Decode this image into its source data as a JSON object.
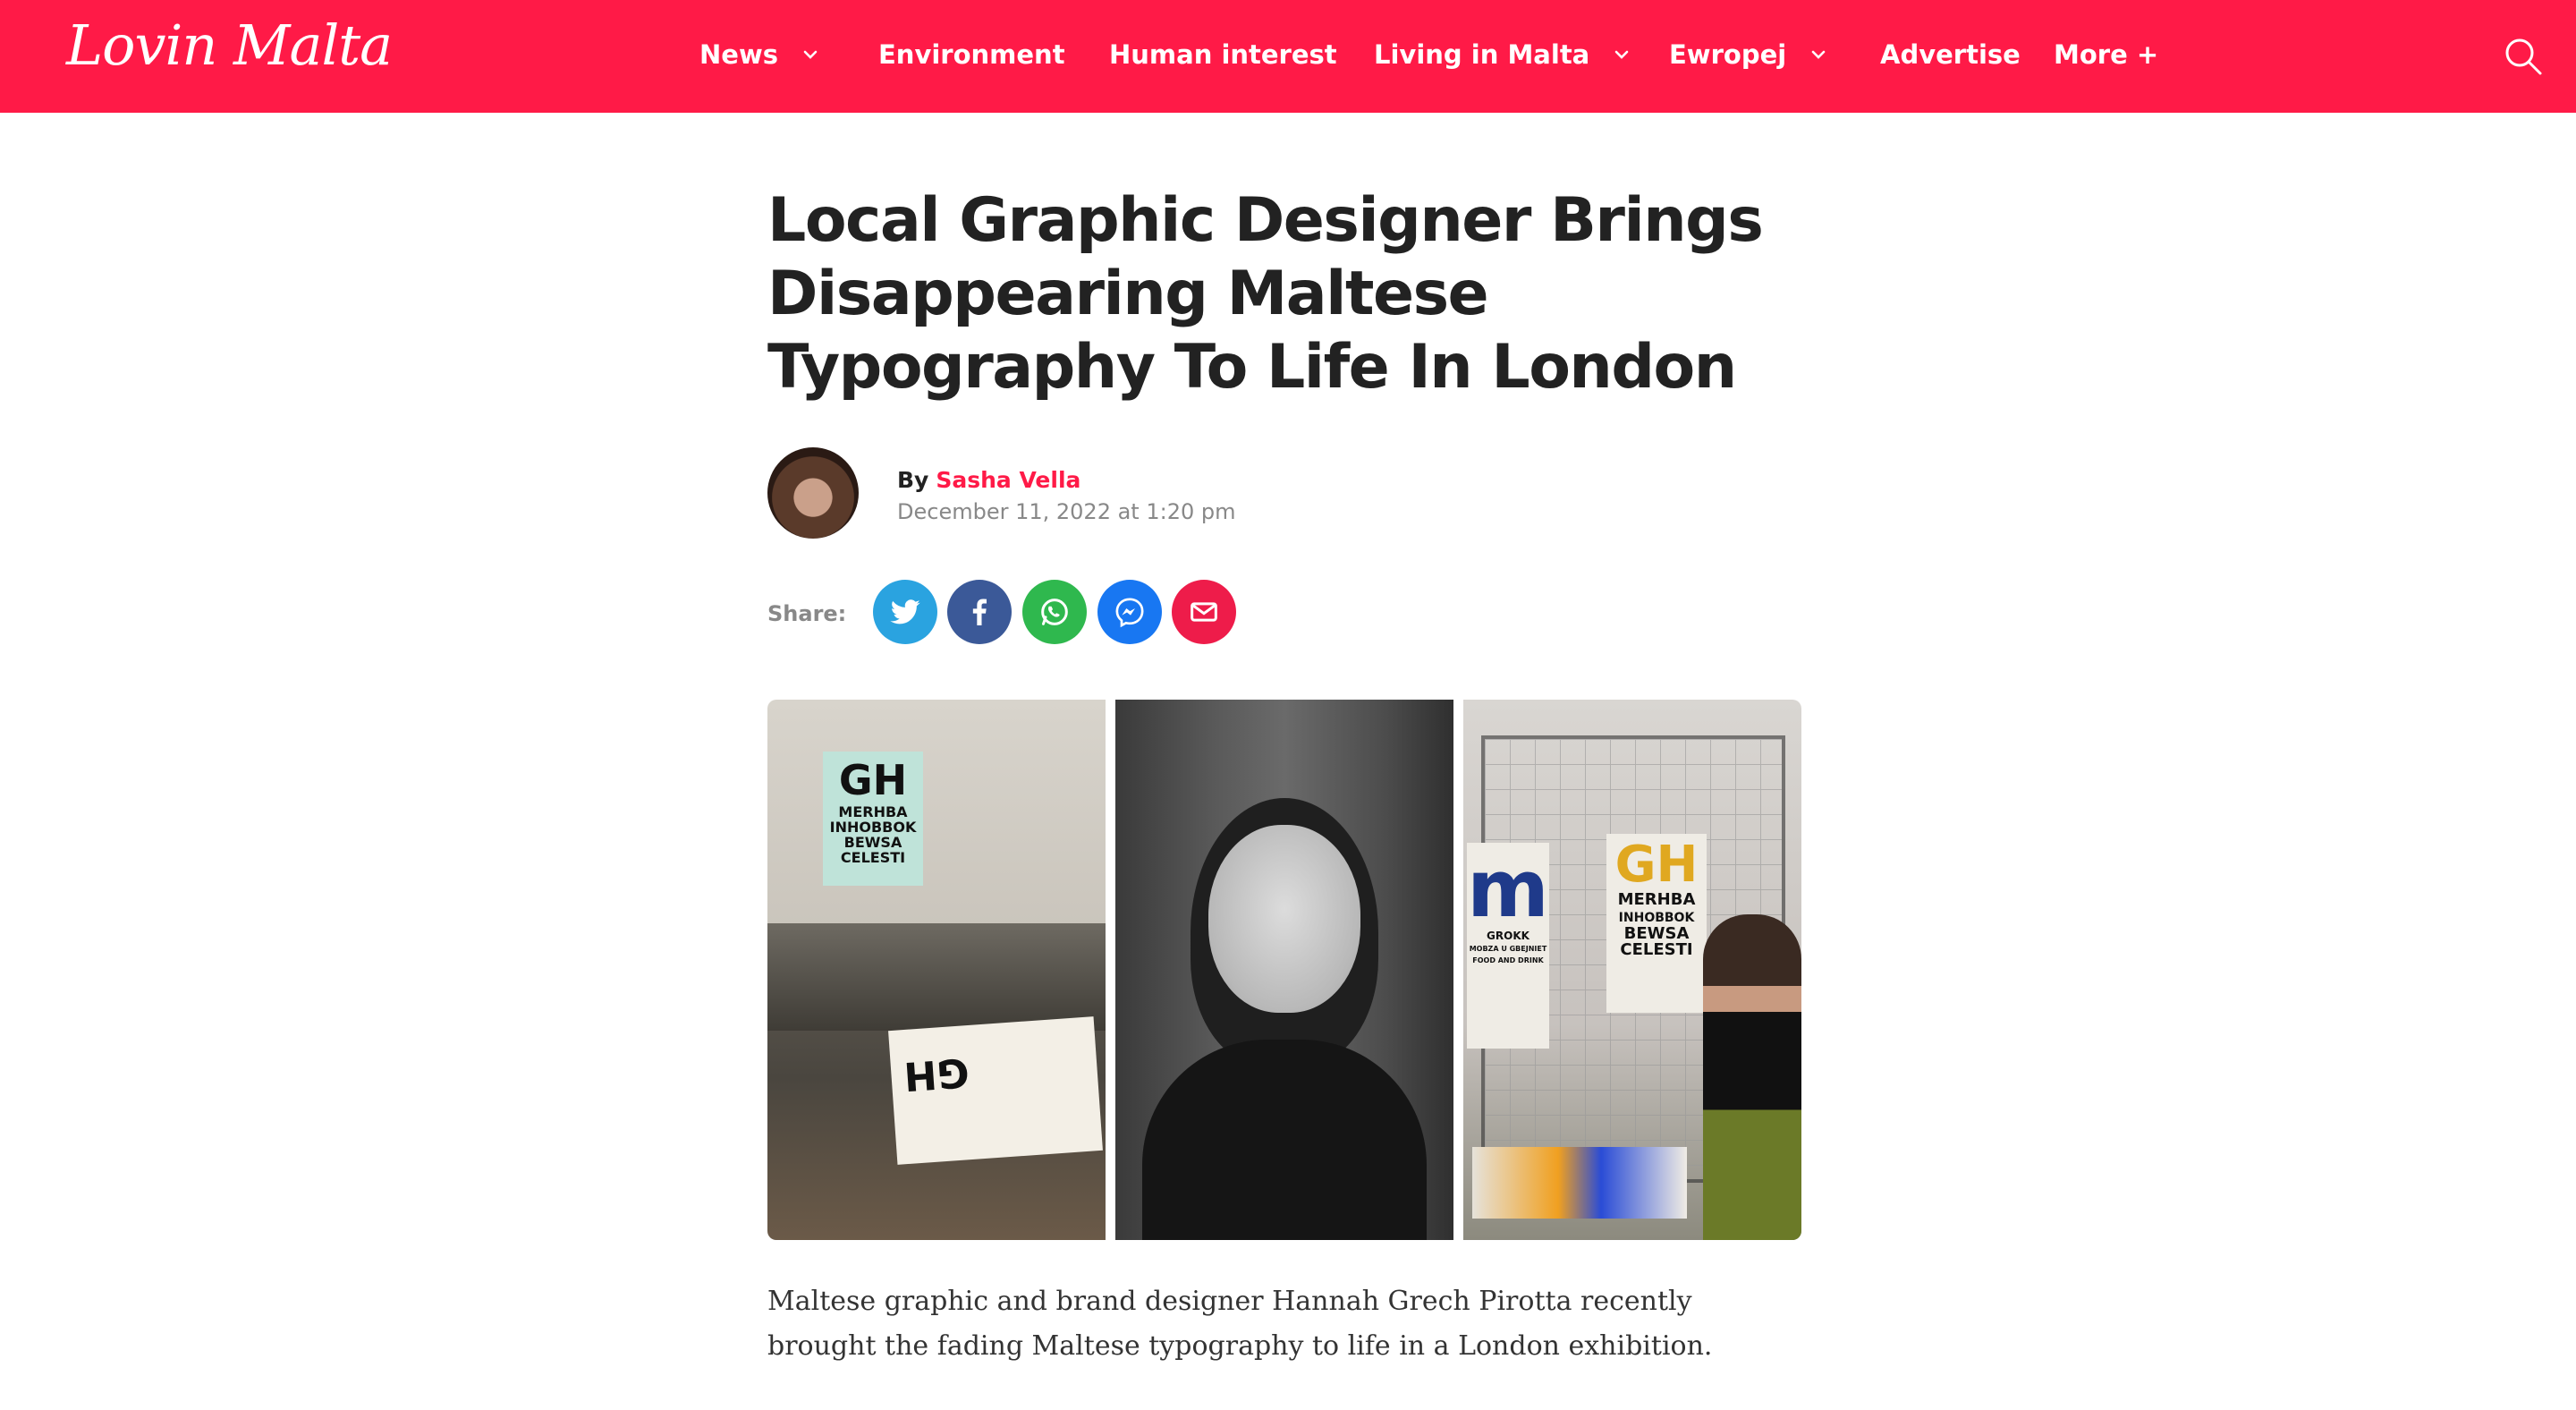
{
  "header": {
    "logo": "Lovin Malta",
    "nav": [
      {
        "label": "News",
        "has_dropdown": true
      },
      {
        "label": "Environment",
        "has_dropdown": false
      },
      {
        "label": "Human interest",
        "has_dropdown": false
      },
      {
        "label": "Living in Malta",
        "has_dropdown": true
      },
      {
        "label": "Ewropej",
        "has_dropdown": true
      },
      {
        "label": "Advertise",
        "has_dropdown": false
      },
      {
        "label": "More +",
        "has_dropdown": false
      }
    ],
    "search_icon": "search-icon",
    "brand_color": "#ff1a47"
  },
  "article": {
    "title": "Local Graphic Designer Brings Disappearing Maltese Typography To Life In London",
    "by": "By",
    "author": "Sasha Vella",
    "date": "December 11, 2022 at 1:20 pm",
    "share_label": "Share:",
    "share_buttons": [
      {
        "name": "twitter",
        "icon": "twitter-icon",
        "color": "#1da1f2"
      },
      {
        "name": "facebook",
        "icon": "facebook-icon",
        "color": "#3b5998"
      },
      {
        "name": "whatsapp",
        "icon": "whatsapp-icon",
        "color": "#25d366"
      },
      {
        "name": "messenger",
        "icon": "messenger-icon",
        "color": "#1877f2"
      },
      {
        "name": "email",
        "icon": "email-icon",
        "color": "#ff1a47"
      }
    ],
    "image_text": {
      "panel1_big": "GH",
      "panel1_lines": [
        "MERHBA",
        "INHOBBOK",
        "BEWSA",
        "CELESTI"
      ],
      "panel1_plate": "GH",
      "panel3_m": "m",
      "panel3_m_caption": [
        "GROKK",
        "MOBZA U GBEJNIET",
        "FOOD AND DRINK"
      ],
      "panel3_gh": "GH",
      "panel3_lines": [
        "MERHBA",
        "INHOBBOK",
        "BEWSA",
        "CELESTI"
      ]
    },
    "paragraph": "Maltese graphic and brand designer Hannah Grech Pirotta recently brought the fading Maltese typography to life in a London exhibition."
  }
}
